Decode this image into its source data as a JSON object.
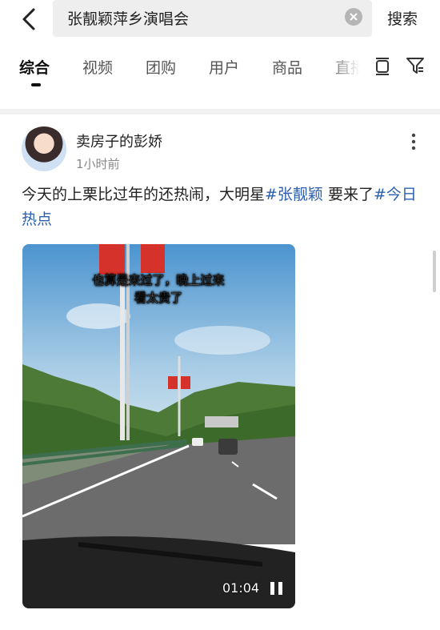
{
  "search": {
    "query": "张靓颖萍乡演唱会",
    "button_label": "搜索"
  },
  "tabs": [
    {
      "label": "综合"
    },
    {
      "label": "视频"
    },
    {
      "label": "团购"
    },
    {
      "label": "用户"
    },
    {
      "label": "商品"
    },
    {
      "label": "直播"
    }
  ],
  "post": {
    "username": "卖房子的彭娇",
    "time_ago": "1小时前",
    "text_part1": "今天的上栗比过年的还热闹，大明星",
    "hashtag1": "#张靓颖",
    "text_part2": " 要来了",
    "hashtag2": "#今日热点"
  },
  "video": {
    "caption_line1": "也算是来过了，晚上过来",
    "caption_line2": "看太贵了",
    "duration": "01:04"
  },
  "colors": {
    "link": "#2a5fb0",
    "background": "#f2f2f2"
  },
  "icons": [
    "back-arrow-icon",
    "clear-icon",
    "list-view-icon",
    "filter-icon",
    "more-icon",
    "pause-icon"
  ]
}
